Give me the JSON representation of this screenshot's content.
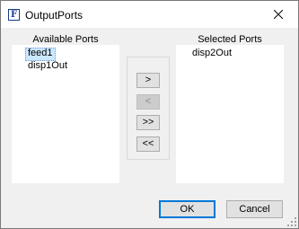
{
  "window": {
    "title": "OutputPorts",
    "app_icon": "form-icon",
    "close_icon": "close-icon"
  },
  "available": {
    "label": "Available Ports",
    "items": [
      {
        "label": "feed1",
        "selected": true
      },
      {
        "label": "disp1Out",
        "selected": false
      }
    ]
  },
  "selected": {
    "label": "Selected Ports",
    "items": [
      {
        "label": "disp2Out",
        "selected": false
      }
    ]
  },
  "move_buttons": {
    "add": {
      "label": ">",
      "enabled": true
    },
    "remove": {
      "label": "<",
      "enabled": false
    },
    "add_all": {
      "label": ">>",
      "enabled": true
    },
    "remove_all": {
      "label": "<<",
      "enabled": true
    }
  },
  "dialog_buttons": {
    "ok": "OK",
    "cancel": "Cancel"
  },
  "colors": {
    "selection": "#cce8ff",
    "default_button_border": "#0078d7",
    "dialog_background": "#f0f0f0"
  }
}
